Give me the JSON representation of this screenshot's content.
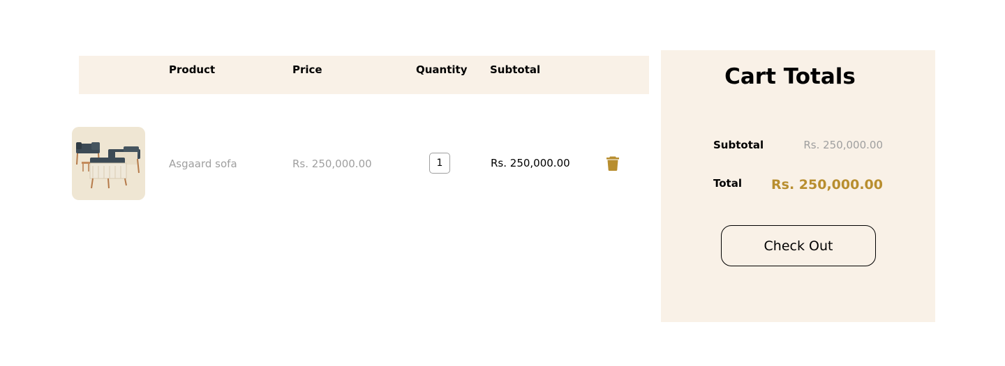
{
  "cart_table": {
    "headers": {
      "product": "Product",
      "price": "Price",
      "quantity": "Quantity",
      "subtotal": "Subtotal"
    },
    "items": [
      {
        "name": "Asgaard sofa",
        "price": "Rs. 250,000.00",
        "quantity": "1",
        "subtotal": "Rs. 250,000.00",
        "delete_icon": "trash-icon"
      }
    ]
  },
  "cart_totals": {
    "title": "Cart Totals",
    "subtotal_label": "Subtotal",
    "subtotal_value": "Rs. 250,000.00",
    "total_label": "Total",
    "total_value": "Rs. 250,000.00",
    "checkout_label": "Check Out"
  },
  "colors": {
    "panel_background": "#f9f1e7",
    "accent_gold": "#b88e2f",
    "muted_text": "#9f9f9f",
    "thumbnail_background": "#efe6d3"
  }
}
